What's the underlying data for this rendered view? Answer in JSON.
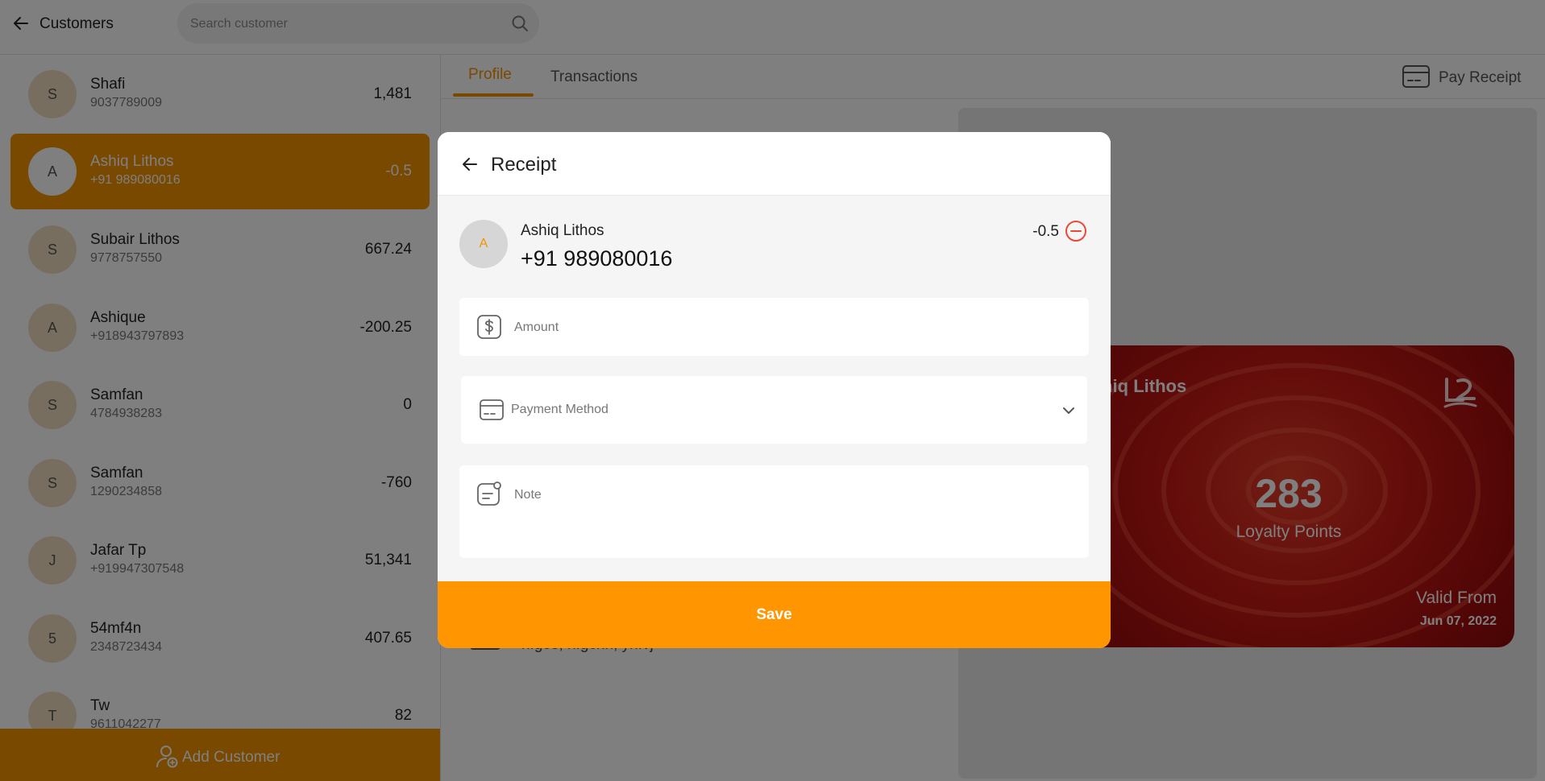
{
  "header": {
    "title": "Customers",
    "search_placeholder": "Search customer"
  },
  "customers": [
    {
      "initial": "S",
      "name": "Shafi",
      "phone": "9037789009",
      "balance": "1,481"
    },
    {
      "initial": "A",
      "name": "Ashiq Lithos",
      "phone": "+91 989080016",
      "balance": "-0.5",
      "selected": true
    },
    {
      "initial": "S",
      "name": "Subair Lithos",
      "phone": "9778757550",
      "balance": "667.24"
    },
    {
      "initial": "A",
      "name": "Ashique",
      "phone": "+918943797893",
      "balance": "-200.25"
    },
    {
      "initial": "S",
      "name": "Samfan",
      "phone": "4784938283",
      "balance": "0"
    },
    {
      "initial": "S",
      "name": "Samfan",
      "phone": "1290234858",
      "balance": "-760"
    },
    {
      "initial": "J",
      "name": "Jafar Tp",
      "phone": "+919947307548",
      "balance": "51,341"
    },
    {
      "initial": "5",
      "name": "54mf4n",
      "phone": "2348723434",
      "balance": "407.65"
    },
    {
      "initial": "T",
      "name": "Tw",
      "phone": "9611042277",
      "balance": "82"
    }
  ],
  "add_customer_label": "Add Customer",
  "tabs": [
    {
      "label": "Profile",
      "active": true
    },
    {
      "label": "Transactions",
      "active": false
    }
  ],
  "pay_receipt_label": "Pay Receipt",
  "loyalty_card": {
    "name": "Ashiq Lithos",
    "points": "283",
    "points_label": "Loyalty Points",
    "valid_label": "Valid From",
    "valid_date": "Jun 07, 2022"
  },
  "address_text": "nfgce, nfgchn, ynfvj",
  "modal": {
    "title": "Receipt",
    "customer": {
      "initial": "A",
      "name": "Ashiq Lithos",
      "phone": "+91 989080016",
      "balance": "-0.5"
    },
    "amount_placeholder": "Amount",
    "payment_method_label": "Payment Method",
    "note_placeholder": "Note",
    "save_label": "Save"
  },
  "colors": {
    "accent": "#f39200",
    "save_button": "#ff9500",
    "negative_indicator": "#e84a3a",
    "card_red": "#c81a14"
  },
  "icons": {
    "back": "arrow-left-icon",
    "search": "search-icon",
    "add_customer": "user-plus-icon",
    "pay_receipt": "card-icon",
    "amount": "dollar-icon",
    "payment": "card-icon",
    "note": "note-icon",
    "balance_indicator": "minus-circle-icon",
    "dropdown": "chevron-down-icon"
  }
}
